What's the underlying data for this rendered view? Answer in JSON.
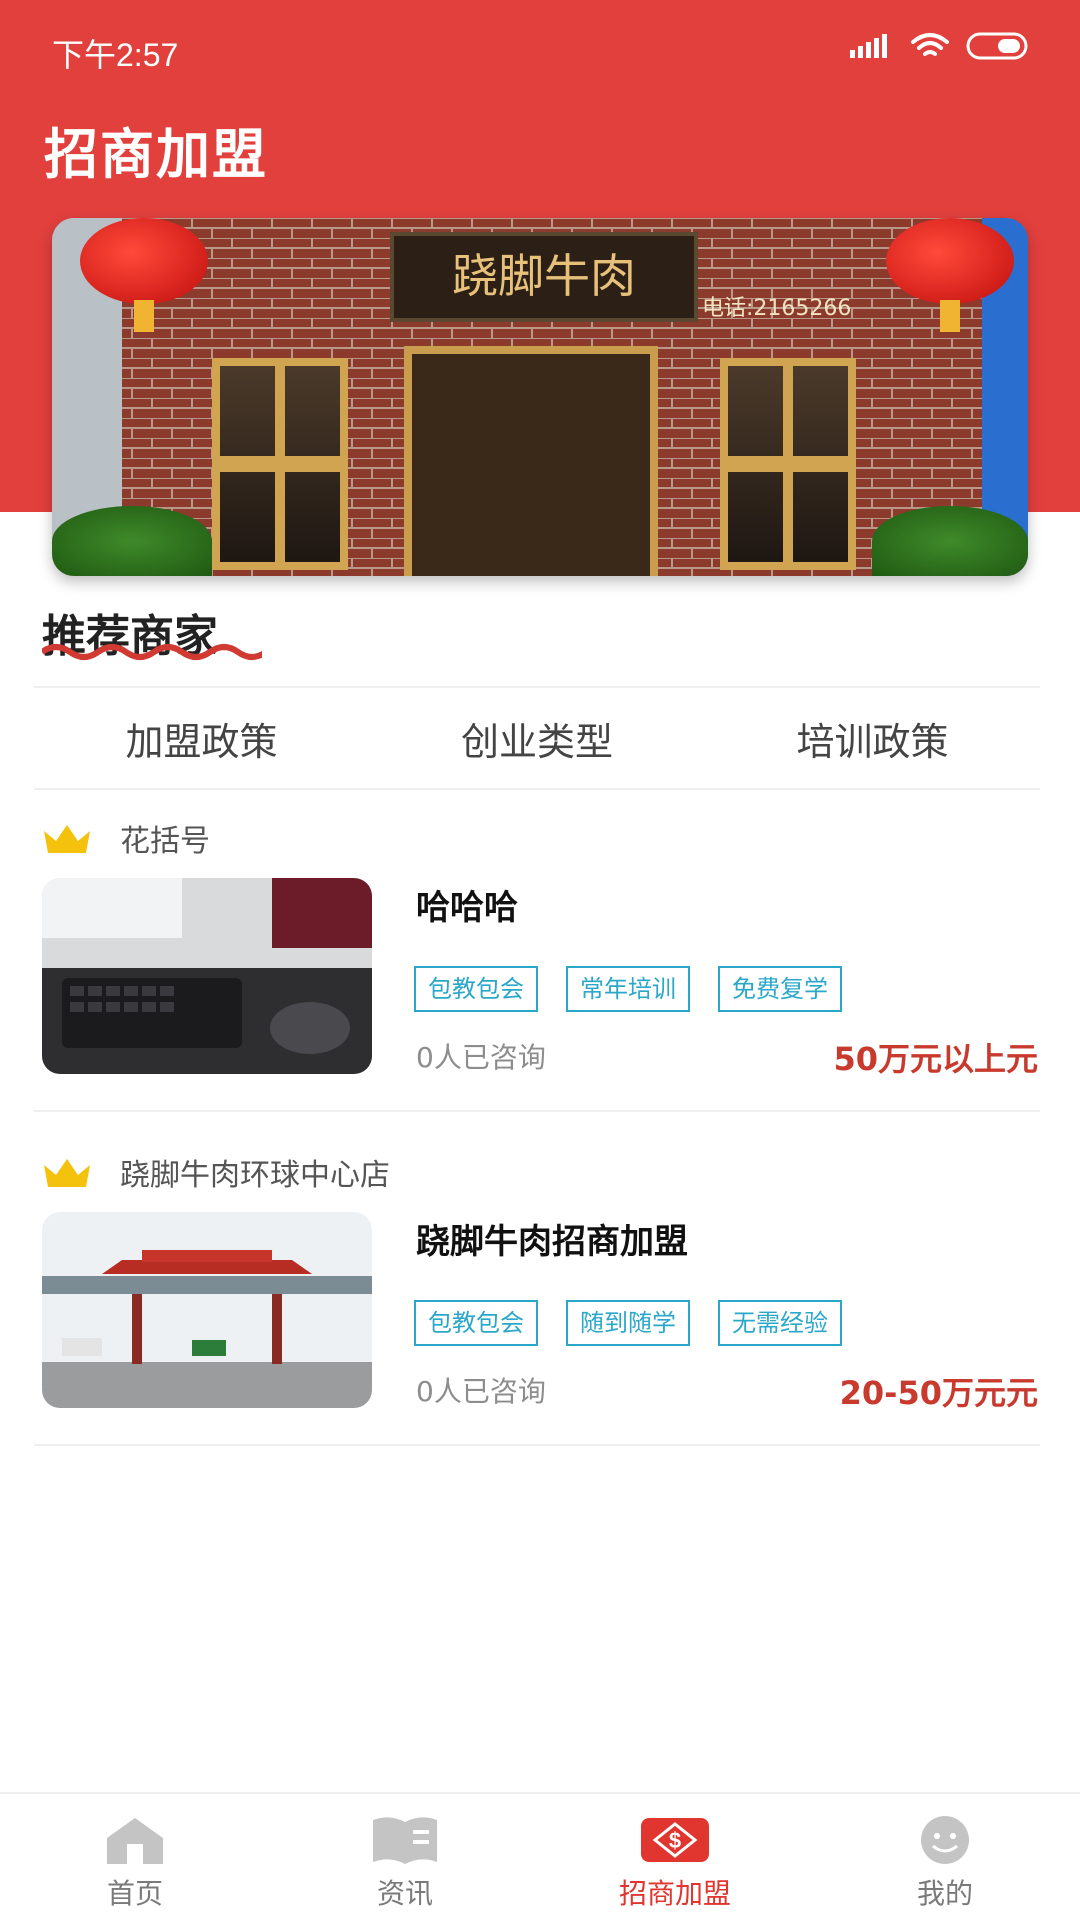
{
  "status_bar": {
    "time": "下午2:57"
  },
  "header": {
    "title": "招商加盟"
  },
  "banner": {
    "sign_text": "跷脚牛肉",
    "phone_text": "电话:2165266"
  },
  "section": {
    "title": "推荐商家"
  },
  "filter_tabs": [
    "加盟政策",
    "创业类型",
    "培训政策"
  ],
  "listings": [
    {
      "shop_name": "花括号",
      "title": "哈哈哈",
      "tags": [
        "包教包会",
        "常年培训",
        "免费复学"
      ],
      "consult": "0人已咨询",
      "price": "50万元以上元"
    },
    {
      "shop_name": "跷脚牛肉环球中心店",
      "title": "跷脚牛肉招商加盟",
      "tags": [
        "包教包会",
        "随到随学",
        "无需经验"
      ],
      "consult": "0人已咨询",
      "price": "20-50万元元"
    }
  ],
  "bottom_nav": {
    "items": [
      "首页",
      "资讯",
      "招商加盟",
      "我的"
    ],
    "active": "招商加盟"
  },
  "colors": {
    "primary_red": "#e2403d",
    "tag_blue": "#2aa7c9",
    "price_red": "#c83a2e",
    "crown_gold": "#f4c20d"
  }
}
